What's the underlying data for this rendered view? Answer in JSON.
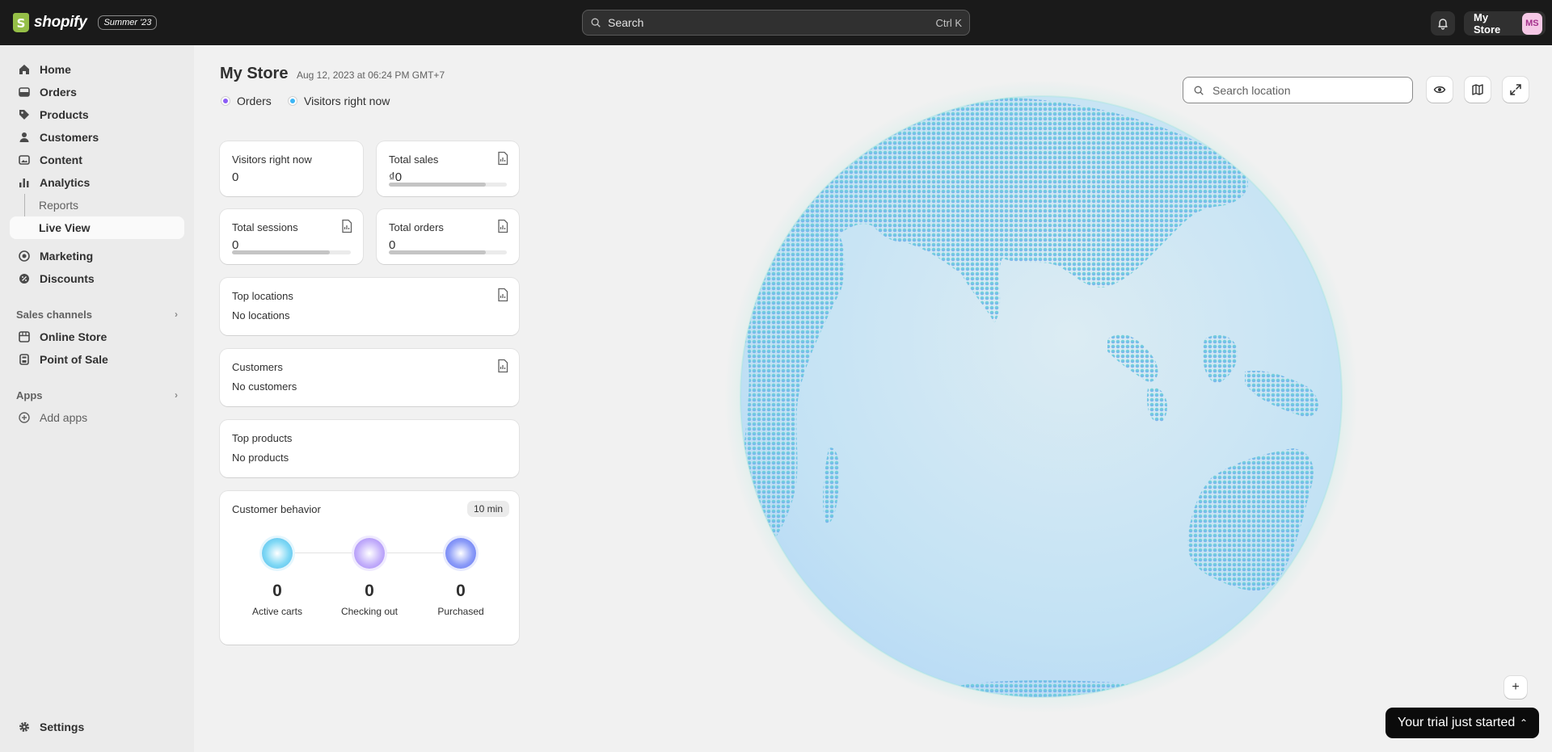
{
  "topbar": {
    "logo_letter": "S",
    "logo_text": "shopify",
    "edition_badge": "Summer '23",
    "search_placeholder": "Search",
    "search_shortcut": "Ctrl K",
    "store_name": "My Store",
    "avatar_initials": "MS"
  },
  "sidebar": {
    "items": [
      {
        "label": "Home",
        "icon": "home-icon"
      },
      {
        "label": "Orders",
        "icon": "orders-icon"
      },
      {
        "label": "Products",
        "icon": "tag-icon"
      },
      {
        "label": "Customers",
        "icon": "person-icon"
      },
      {
        "label": "Content",
        "icon": "image-icon"
      },
      {
        "label": "Analytics",
        "icon": "bar-chart-icon"
      }
    ],
    "analytics_sub": [
      "Reports",
      "Live View"
    ],
    "marketing": "Marketing",
    "discounts": "Discounts",
    "sales_channels": "Sales channels",
    "channels": [
      "Online Store",
      "Point of Sale"
    ],
    "apps": "Apps",
    "add_apps": "Add apps",
    "settings": "Settings"
  },
  "header": {
    "title": "My Store",
    "timestamp": "Aug 12, 2023 at 06:24 PM GMT+7"
  },
  "legend": {
    "orders": "Orders",
    "visitors": "Visitors right now",
    "orders_color": "#8b5cf6",
    "visitors_color": "#3bb5f5"
  },
  "metrics": {
    "visitors": {
      "label": "Visitors right now",
      "value": "0"
    },
    "sales": {
      "label": "Total sales",
      "value": "₫0",
      "progress": 0.82
    },
    "sessions": {
      "label": "Total sessions",
      "value": "0",
      "progress": 0.82
    },
    "orders": {
      "label": "Total orders",
      "value": "0",
      "progress": 0.82
    }
  },
  "lists": {
    "locations": {
      "title": "Top locations",
      "empty": "No locations"
    },
    "customers": {
      "title": "Customers",
      "empty": "No customers"
    },
    "products": {
      "title": "Top products",
      "empty": "No products"
    }
  },
  "behavior": {
    "title": "Customer behavior",
    "window": "10 min",
    "stages": [
      {
        "value": "0",
        "label": "Active carts",
        "color": "#5ac8f0"
      },
      {
        "value": "0",
        "label": "Checking out",
        "color": "#a78bfa"
      },
      {
        "value": "0",
        "label": "Purchased",
        "color": "#6b7cf5"
      }
    ]
  },
  "map": {
    "search_placeholder": "Search location",
    "zoom_in": "+",
    "trial_banner": "Your trial just started"
  }
}
